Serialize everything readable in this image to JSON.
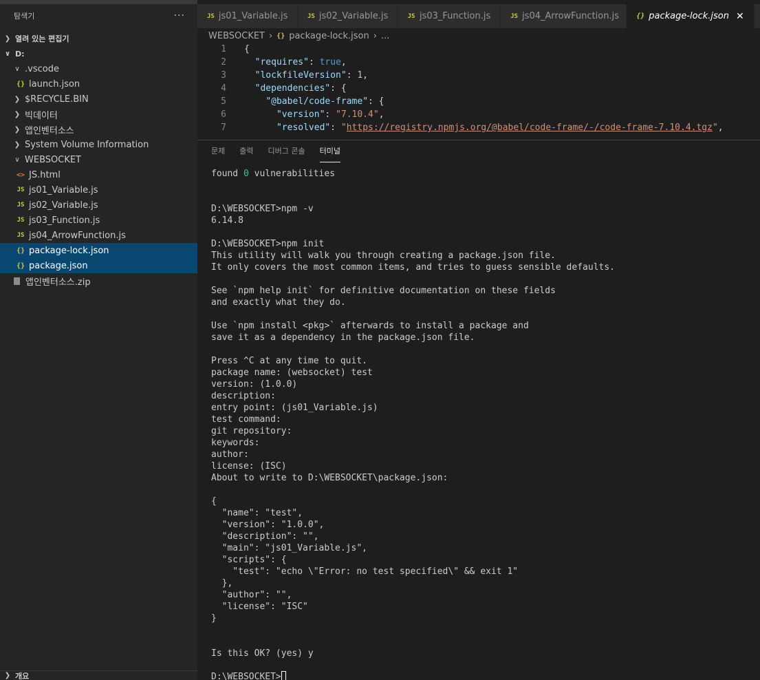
{
  "sidebar": {
    "title": "탐색기",
    "more": "···",
    "open_editors": "열려 있는 편집기",
    "root": "D:",
    "items": [
      {
        "label": ".vscode",
        "kind": "folder-open",
        "indent": 1
      },
      {
        "label": "launch.json",
        "kind": "json",
        "indent": 2
      },
      {
        "label": "$RECYCLE.BIN",
        "kind": "folder",
        "indent": 1
      },
      {
        "label": "빅데이터",
        "kind": "folder",
        "indent": 1
      },
      {
        "label": "앱인벤터소스",
        "kind": "folder",
        "indent": 1
      },
      {
        "label": "System Volume Information",
        "kind": "folder",
        "indent": 1
      },
      {
        "label": "WEBSOCKET",
        "kind": "folder-open",
        "indent": 1
      },
      {
        "label": "JS.html",
        "kind": "html",
        "indent": 2
      },
      {
        "label": "js01_Variable.js",
        "kind": "js",
        "indent": 2
      },
      {
        "label": "js02_Variable.js",
        "kind": "js",
        "indent": 2
      },
      {
        "label": "js03_Function.js",
        "kind": "js",
        "indent": 2
      },
      {
        "label": "js04_ArrowFunction.js",
        "kind": "js",
        "indent": 2
      },
      {
        "label": "package-lock.json",
        "kind": "json",
        "indent": 2,
        "selected": true
      },
      {
        "label": "package.json",
        "kind": "json",
        "indent": 2,
        "selected": true
      },
      {
        "label": "앱인벤터소스.zip",
        "kind": "zip",
        "indent": 1
      }
    ],
    "footer": "개요"
  },
  "tabs": [
    {
      "label": "js01_Variable.js",
      "icon": "JS"
    },
    {
      "label": "js02_Variable.js",
      "icon": "JS"
    },
    {
      "label": "js03_Function.js",
      "icon": "JS"
    },
    {
      "label": "js04_ArrowFunction.js",
      "icon": "JS"
    },
    {
      "label": "package-lock.json",
      "icon": "{}",
      "active": true
    }
  ],
  "breadcrumb": {
    "folder": "WEBSOCKET",
    "file": "package-lock.json",
    "more": "..."
  },
  "editor": {
    "lines": [
      {
        "num": "1",
        "parts": [
          [
            "p",
            "{"
          ]
        ]
      },
      {
        "num": "2",
        "parts": [
          [
            "p",
            "  "
          ],
          [
            "k",
            "\"requires\""
          ],
          [
            "p",
            ": "
          ],
          [
            "b",
            "true"
          ],
          [
            "p",
            ","
          ]
        ]
      },
      {
        "num": "3",
        "parts": [
          [
            "p",
            "  "
          ],
          [
            "k",
            "\"lockfileVersion\""
          ],
          [
            "p",
            ": "
          ],
          [
            "n",
            "1"
          ],
          [
            "p",
            ","
          ]
        ]
      },
      {
        "num": "4",
        "parts": [
          [
            "p",
            "  "
          ],
          [
            "k",
            "\"dependencies\""
          ],
          [
            "p",
            ": {"
          ]
        ]
      },
      {
        "num": "5",
        "parts": [
          [
            "p",
            "    "
          ],
          [
            "k",
            "\"@babel/code-frame\""
          ],
          [
            "p",
            ": {"
          ]
        ]
      },
      {
        "num": "6",
        "parts": [
          [
            "p",
            "      "
          ],
          [
            "k",
            "\"version\""
          ],
          [
            "p",
            ": "
          ],
          [
            "s",
            "\"7.10.4\""
          ],
          [
            "p",
            ","
          ]
        ]
      },
      {
        "num": "7",
        "parts": [
          [
            "p",
            "      "
          ],
          [
            "k",
            "\"resolved\""
          ],
          [
            "p",
            ": "
          ],
          [
            "s",
            "\""
          ],
          [
            "u",
            "https://registry.npmjs.org/@babel/code-frame/-/code-frame-7.10.4.tgz"
          ],
          [
            "s",
            "\""
          ],
          [
            "p",
            ","
          ]
        ]
      }
    ]
  },
  "panel": {
    "tabs": [
      "문제",
      "출력",
      "디버그 콘솔",
      "터미널"
    ],
    "active_tab": "터미널",
    "terminal": [
      "found 0 vulnerabilities",
      "",
      "",
      "D:\\WEBSOCKET>npm -v",
      "6.14.8",
      "",
      "D:\\WEBSOCKET>npm init",
      "This utility will walk you through creating a package.json file.",
      "It only covers the most common items, and tries to guess sensible defaults.",
      "",
      "See `npm help init` for definitive documentation on these fields",
      "and exactly what they do.",
      "",
      "Use `npm install <pkg>` afterwards to install a package and",
      "save it as a dependency in the package.json file.",
      "",
      "Press ^C at any time to quit.",
      "package name: (websocket) test",
      "version: (1.0.0)",
      "description:",
      "entry point: (js01_Variable.js)",
      "test command:",
      "git repository:",
      "keywords:",
      "author:",
      "license: (ISC)",
      "About to write to D:\\WEBSOCKET\\package.json:",
      "",
      "{",
      "  \"name\": \"test\",",
      "  \"version\": \"1.0.0\",",
      "  \"description\": \"\",",
      "  \"main\": \"js01_Variable.js\",",
      "  \"scripts\": {",
      "    \"test\": \"echo \\\"Error: no test specified\\\" && exit 1\"",
      "  },",
      "  \"author\": \"\",",
      "  \"license\": \"ISC\"",
      "}",
      "",
      "",
      "Is this OK? (yes) y",
      "",
      "D:\\WEBSOCKET>"
    ]
  },
  "colors": {
    "selection": "#094771",
    "sidebar_bg": "#252526",
    "editor_bg": "#1e1e1e"
  }
}
